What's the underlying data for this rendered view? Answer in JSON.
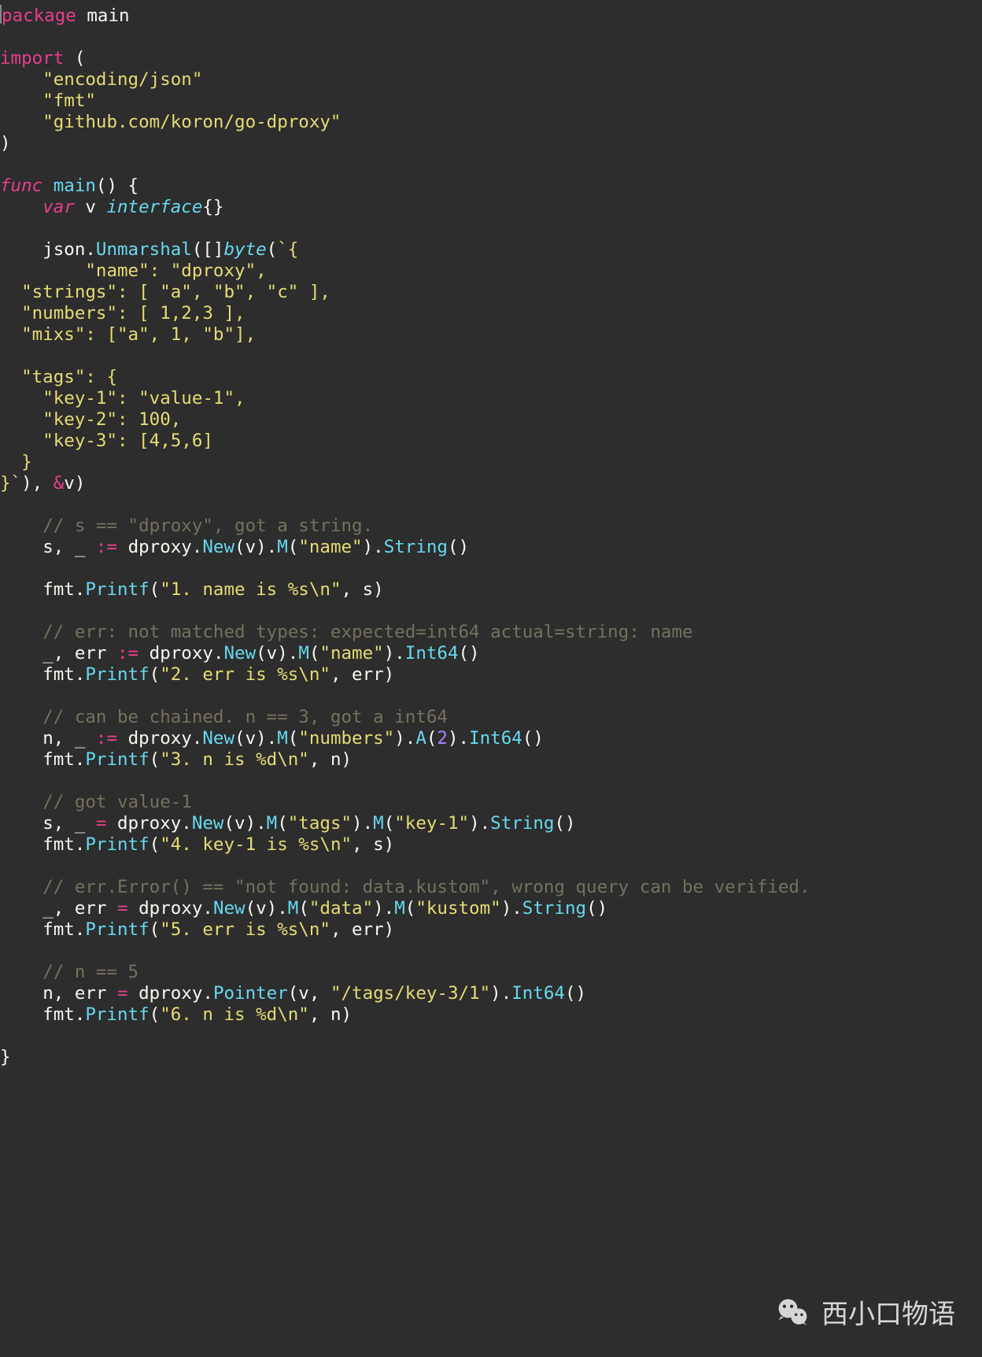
{
  "watermark_text": "西小口物语",
  "code": {
    "pkg_kw": "package",
    "pkg_name": "main",
    "import_kw": "import",
    "imp1": "\"encoding/json\"",
    "imp2": "\"fmt\"",
    "imp3": "\"github.com/koron/go-dproxy\"",
    "func_kw": "func",
    "main_name": "main",
    "var_kw": "var",
    "var_name": "v",
    "iface_kw": "interface",
    "byte_kw": "byte",
    "json_lit_open": "`{",
    "json_name_k": "\"name\"",
    "json_name_v": "\"dproxy\"",
    "json_strings_k": "\"strings\"",
    "json_strings_a": "\"a\"",
    "json_strings_b": "\"b\"",
    "json_strings_c": "\"c\"",
    "json_numbers_k": "\"numbers\"",
    "json_mixs_k": "\"mixs\"",
    "json_mixs_a": "\"a\"",
    "json_mixs_b": "\"b\"",
    "json_tags_k": "\"tags\"",
    "json_key1_k": "\"key-1\"",
    "json_key1_v": "\"value-1\"",
    "json_key2_k": "\"key-2\"",
    "json_key3_k": "\"key-3\"",
    "close_tick": "`",
    "cmt1": "// s == \"dproxy\", got a string.",
    "cmt2": "// err: not matched types: expected=int64 actual=string: name",
    "cmt3": "// can be chained. n == 3, got a int64",
    "cmt4": "// got value-1",
    "cmt5": "// err.Error() == \"not found: data.kustom\", wrong query can be verified.",
    "cmt6": "// n == 5",
    "dproxy": "dproxy",
    "json_ident": "json",
    "fmt_ident": "fmt",
    "New": "New",
    "M": "M",
    "A": "A",
    "String": "String",
    "Int64": "Int64",
    "Unmarshal": "Unmarshal",
    "Printf": "Printf",
    "Pointer": "Pointer",
    "arg_name": "\"name\"",
    "arg_numbers": "\"numbers\"",
    "arg_tags": "\"tags\"",
    "arg_key1": "\"key-1\"",
    "arg_data": "\"data\"",
    "arg_kustom": "\"kustom\"",
    "arg_ptr": "\"/tags/key-3/1\"",
    "pf1": "\"1. name is %s\\n\"",
    "pf2": "\"2. err is %s\\n\"",
    "pf3": "\"3. n is %d\\n\"",
    "pf4": "\"4. key-1 is %s\\n\"",
    "pf5": "\"5. err is %s\\n\"",
    "pf6": "\"6. n is %d\\n\"",
    "n1": "1",
    "n2": "2",
    "n3": "3",
    "n4": "4",
    "n5": "5",
    "n6": "6",
    "n100": "100"
  }
}
